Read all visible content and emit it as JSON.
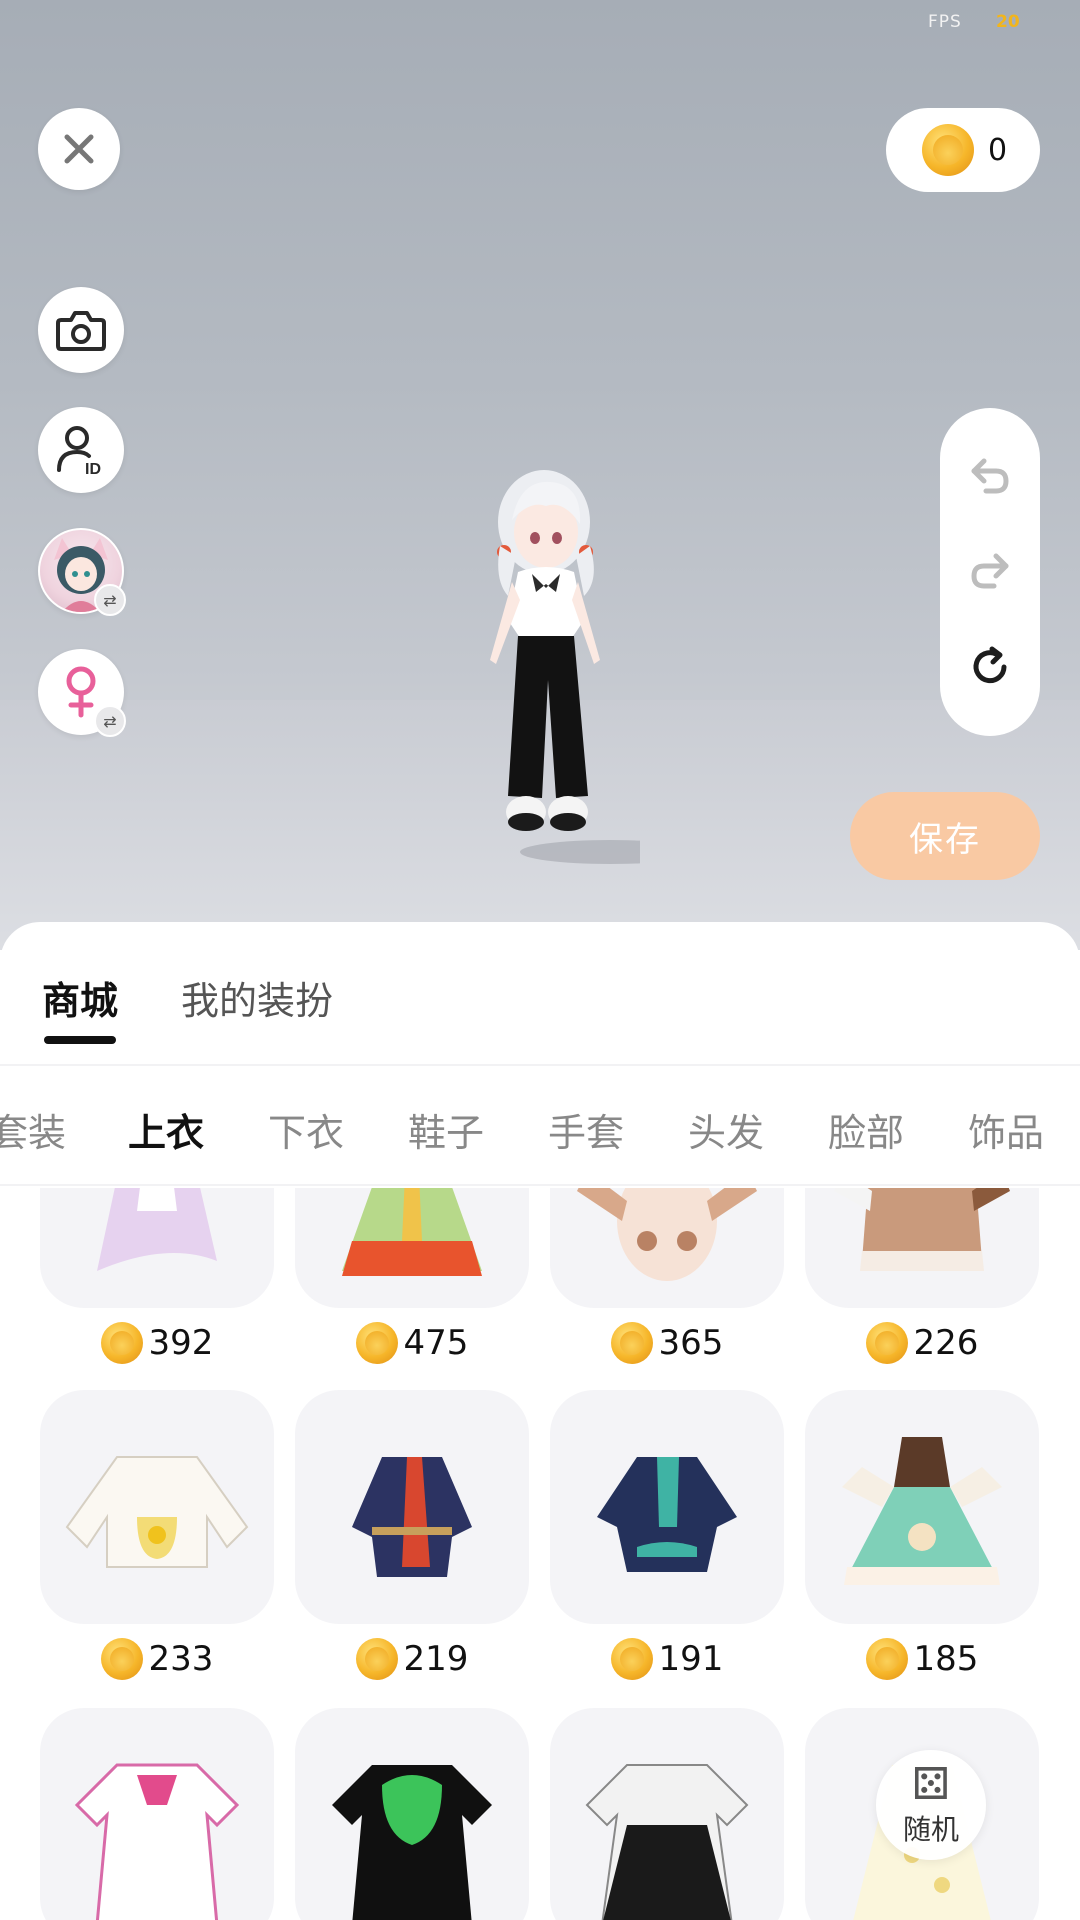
{
  "status": {
    "fps_label": "FPS",
    "fps_value": "20"
  },
  "wallet": {
    "coins": "0"
  },
  "actions": {
    "save_label": "保存"
  },
  "main_tabs": [
    {
      "label": "商城",
      "active": true
    },
    {
      "label": "我的装扮",
      "active": false
    }
  ],
  "categories": [
    {
      "label": "套装",
      "active": false
    },
    {
      "label": "上衣",
      "active": true
    },
    {
      "label": "下衣",
      "active": false
    },
    {
      "label": "鞋子",
      "active": false
    },
    {
      "label": "手套",
      "active": false
    },
    {
      "label": "头发",
      "active": false
    },
    {
      "label": "脸部",
      "active": false
    },
    {
      "label": "饰品",
      "active": false
    }
  ],
  "items": [
    {
      "price": "392"
    },
    {
      "price": "475"
    },
    {
      "price": "365"
    },
    {
      "price": "226"
    },
    {
      "price": "233"
    },
    {
      "price": "219"
    },
    {
      "price": "191"
    },
    {
      "price": "185"
    },
    {
      "price": ""
    },
    {
      "price": ""
    },
    {
      "price": ""
    },
    {
      "price": ""
    }
  ],
  "random": {
    "label": "随机"
  },
  "colors": {
    "accent_save": "#f9c9a3",
    "coin_gold": "#f6b62a",
    "fps_value": "#f2b51b",
    "card_bg": "#f4f4f7"
  },
  "icons": {
    "close": "close-icon",
    "camera": "camera-icon",
    "id": "user-id-icon",
    "gender": "female-icon",
    "undo": "undo-icon",
    "redo": "redo-icon",
    "reset": "reset-icon",
    "dice": "dice-icon"
  }
}
